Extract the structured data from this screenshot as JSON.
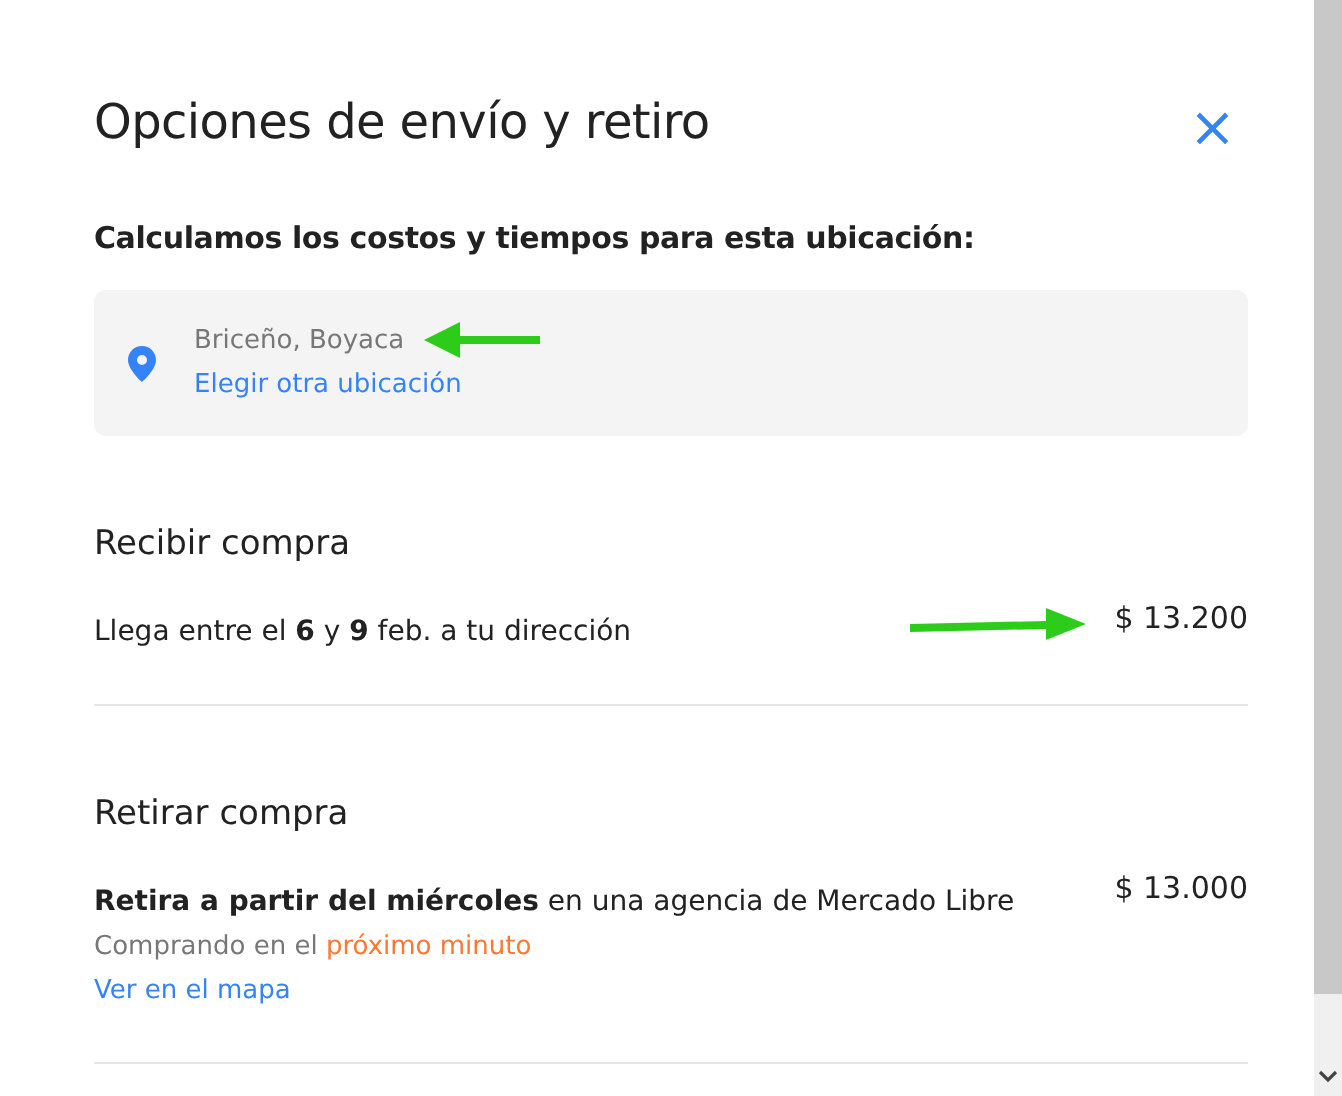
{
  "title": "Opciones de envío y retiro",
  "close": "×",
  "subtitle": "Calculamos los costos y tiempos para esta ubicación:",
  "location": {
    "place": "Briceño, Boyaca",
    "link": "Elegir otra ubicación"
  },
  "sections": [
    {
      "heading": "Recibir compra",
      "text": "Llega entre el **6** y **9** feb. a tu dirección",
      "price": "$ 13.200"
    },
    {
      "heading": "Retirar compra",
      "text": "**Retira a partir del miércoles** en una agencia de Mercado Libre",
      "price": "$ 13.000",
      "note": "Comprando en el",
      "note_highlight": "próximo minuto",
      "link": "Ver en el mapa"
    }
  ]
}
